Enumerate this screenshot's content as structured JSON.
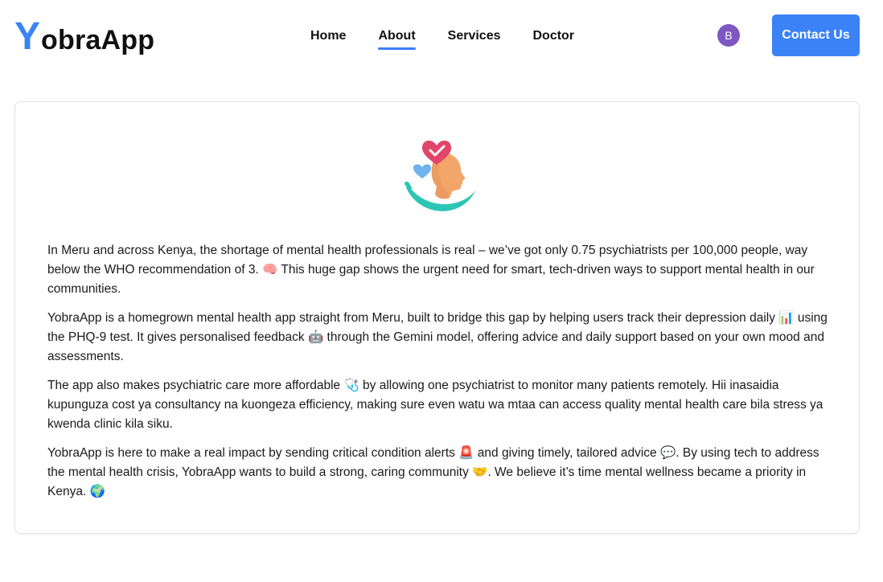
{
  "header": {
    "logo_first": "Y",
    "logo_rest": "obraApp",
    "nav": [
      {
        "label": "Home",
        "active": false
      },
      {
        "label": "About",
        "active": true
      },
      {
        "label": "Services",
        "active": false
      },
      {
        "label": "Doctor",
        "active": false
      }
    ],
    "avatar_initial": "B",
    "contact_label": "Contact Us"
  },
  "about": {
    "illustration_icon": "mental-health-head-heart-icon",
    "paragraphs": [
      "In Meru and across Kenya, the shortage of mental health professionals is real – we’ve got only 0.75 psychiatrists per 100,000 people, way below the WHO recommendation of 3. 🧠 This huge gap shows the urgent need for smart, tech-driven ways to support mental health in our communities.",
      "YobraApp is a homegrown mental health app straight from Meru, built to bridge this gap by helping users track their depression daily 📊 using the PHQ-9 test. It gives personalised feedback 🤖 through the Gemini model, offering advice and daily support based on your own mood and assessments.",
      "The app also makes psychiatric care more affordable 🩺 by allowing one psychiatrist to monitor many patients remotely. Hii inasaidia kupunguza cost ya consultancy na kuongeza efficiency, making sure even watu wa mtaa can access quality mental health care bila stress ya kwenda clinic kila siku.",
      "YobraApp is here to make a real impact by sending critical condition alerts 🚨 and giving timely, tailored advice 💬. By using tech to address the mental health crisis, YobraApp wants to build a strong, caring community 🤝. We believe it’s time mental wellness became a priority in Kenya. 🌍"
    ]
  },
  "colors": {
    "accent": "#3b82f6",
    "avatar": "#7e57c2",
    "heart": "#e2456b",
    "heart_small": "#6fb3f0",
    "hand": "#2cc6b4",
    "skin": "#f2a66a"
  }
}
